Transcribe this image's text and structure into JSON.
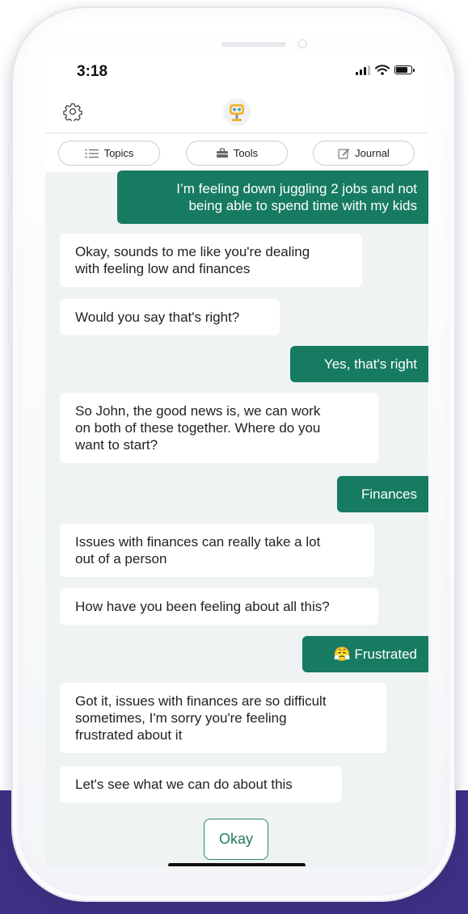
{
  "status_bar": {
    "time": "3:18"
  },
  "header": {
    "settings_icon": "gear-icon",
    "avatar_icon": "robot-avatar-icon"
  },
  "tabs": [
    {
      "label": "Topics",
      "icon": "list-icon"
    },
    {
      "label": "Tools",
      "icon": "toolbox-icon"
    },
    {
      "label": "Journal",
      "icon": "edit-icon"
    }
  ],
  "messages": {
    "m1": {
      "sender": "user",
      "line1": "I’m feeling down juggling 2 jobs and not",
      "line2": "being able to spend time with my kids"
    },
    "m2": {
      "sender": "bot",
      "line1": "Okay, sounds to me like you're dealing",
      "line2": "with feeling low and finances"
    },
    "m3": {
      "sender": "bot",
      "line1": "Would you say that's right?"
    },
    "m4": {
      "sender": "user",
      "line1": "Yes, that's right"
    },
    "m5": {
      "sender": "bot",
      "line1": "So John, the good news is, we can work",
      "line2": "on both of these together. Where do you",
      "line3": "want to start?"
    },
    "m6": {
      "sender": "user",
      "line1": "Finances"
    },
    "m7": {
      "sender": "bot",
      "line1": "Issues with finances can really take a lot",
      "line2": "out of a person"
    },
    "m8": {
      "sender": "bot",
      "line1": "How have you been feeling about all this?"
    },
    "m9": {
      "sender": "user",
      "emoji": "😤",
      "line1": "Frustrated"
    },
    "m10": {
      "sender": "bot",
      "line1": "Got it, issues with finances are so difficult",
      "line2": "sometimes, I'm sorry you're feeling",
      "line3": "frustrated about it"
    },
    "m11": {
      "sender": "bot",
      "line1": "Let's see what we can do about this"
    }
  },
  "reply_button": {
    "label": "Okay"
  },
  "colors": {
    "user_bubble": "#177b62",
    "chat_background": "#eff3f3",
    "backdrop": "#3f2f86"
  }
}
